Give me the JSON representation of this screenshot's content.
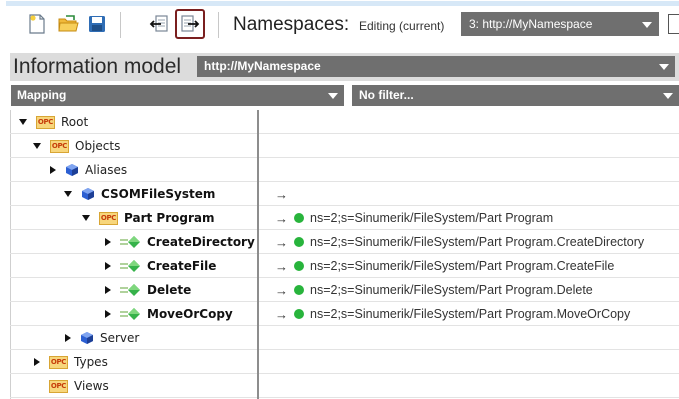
{
  "toolbar": {
    "namespaces_label": "Namespaces:",
    "editing_label": "Editing (current)",
    "namespace_select": "3: http://MyNamespace"
  },
  "info": {
    "title": "Information model",
    "model_select": "http://MyNamespace"
  },
  "mapping": {
    "mapping_select": "Mapping",
    "filter_select": "No filter..."
  },
  "tree": {
    "root": "Root",
    "objects": "Objects",
    "aliases": "Aliases",
    "csom": "CSOMFileSystem",
    "part_program": "Part Program",
    "create_directory": "CreateDirectory",
    "create_file": "CreateFile",
    "delete": "Delete",
    "move_or_copy": "MoveOrCopy",
    "server": "Server",
    "types": "Types",
    "views": "Views"
  },
  "map": {
    "arrow": "→",
    "part_program": "ns=2;s=Sinumerik/FileSystem/Part Program",
    "create_directory": "ns=2;s=Sinumerik/FileSystem/Part Program.CreateDirectory",
    "create_file": "ns=2;s=Sinumerik/FileSystem/Part Program.CreateFile",
    "delete": "ns=2;s=Sinumerik/FileSystem/Part Program.Delete",
    "move_or_copy": "ns=2;s=Sinumerik/FileSystem/Part Program.MoveOrCopy"
  },
  "icons": {
    "opc_text": "OPC",
    "status_color": "#28b43c",
    "highlight_border": "#7a1f1f"
  }
}
